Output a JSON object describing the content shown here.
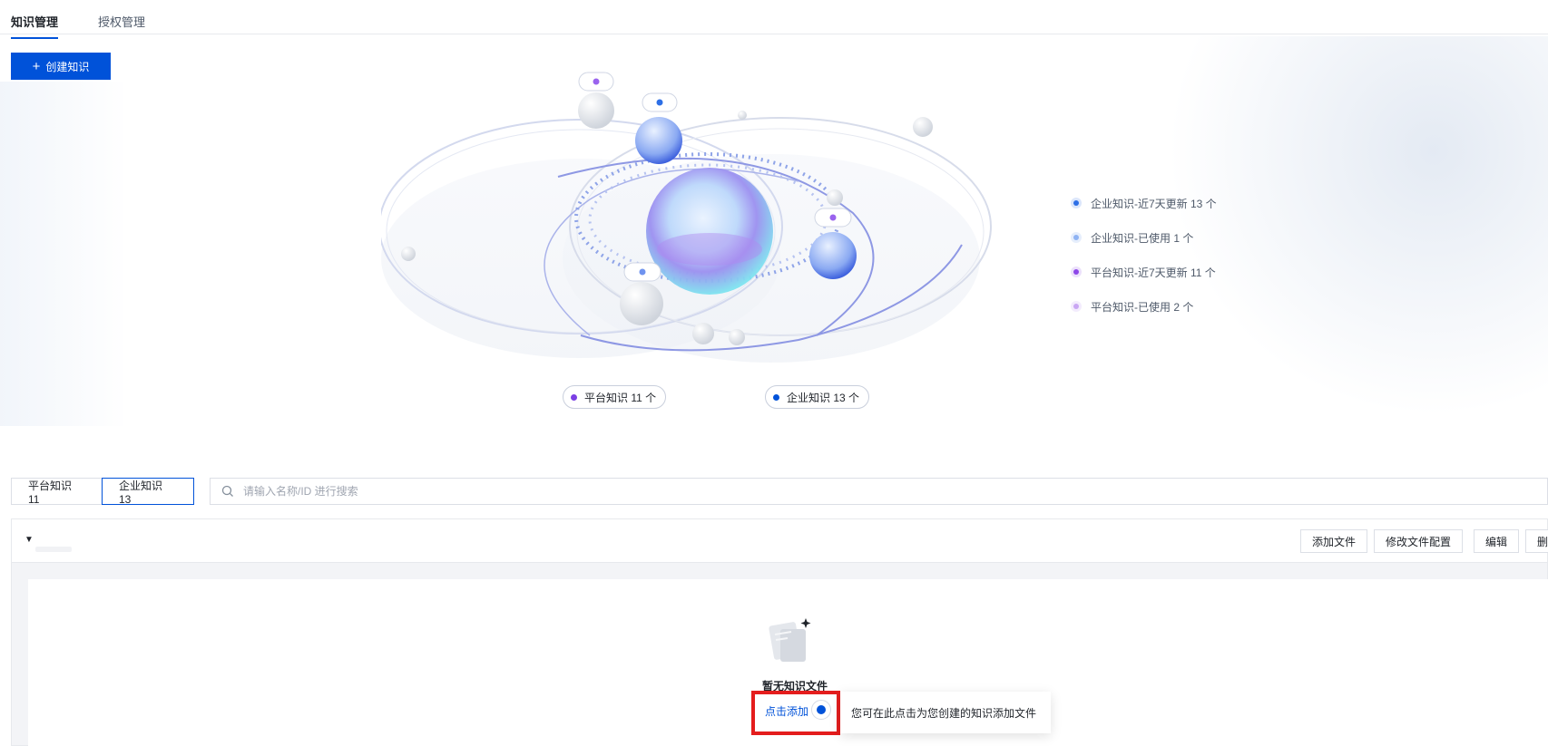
{
  "tabs": [
    {
      "label": "知识管理",
      "active": true
    },
    {
      "label": "授权管理",
      "active": false
    }
  ],
  "create_button": {
    "icon": "plus-icon",
    "label": "创建知识"
  },
  "orbit_tags": {
    "platform": {
      "label": "平台知识 11 个",
      "color": "#7b3fe4"
    },
    "enterprise": {
      "label": "企业知识 13 个",
      "color": "#0052d9"
    }
  },
  "legend": [
    {
      "label": "企业知识-近7天更新 13 个",
      "color": "#2d6fe6",
      "ring": "#dbe6fb"
    },
    {
      "label": "企业知识-已使用 1 个",
      "color": "#8fb3f3",
      "ring": "#e6eefc"
    },
    {
      "label": "平台知识-近7天更新 11 个",
      "color": "#8d47e8",
      "ring": "#ece1fb"
    },
    {
      "label": "平台知识-已使用 2 个",
      "color": "#c9a6f3",
      "ring": "#f3ecfd"
    }
  ],
  "segments": [
    {
      "label": "平台知识 11",
      "active": false
    },
    {
      "label": "企业知识 13",
      "active": true
    }
  ],
  "search": {
    "placeholder": "请输入名称/ID 进行搜索",
    "value": ""
  },
  "panel": {
    "buttons": [
      "添加文件",
      "修改文件配置",
      "编辑",
      "删"
    ],
    "empty_title": "暂无知识文件",
    "add_link": "点击添加",
    "tooltip": "您可在此点击为您创建的知识添加文件"
  }
}
